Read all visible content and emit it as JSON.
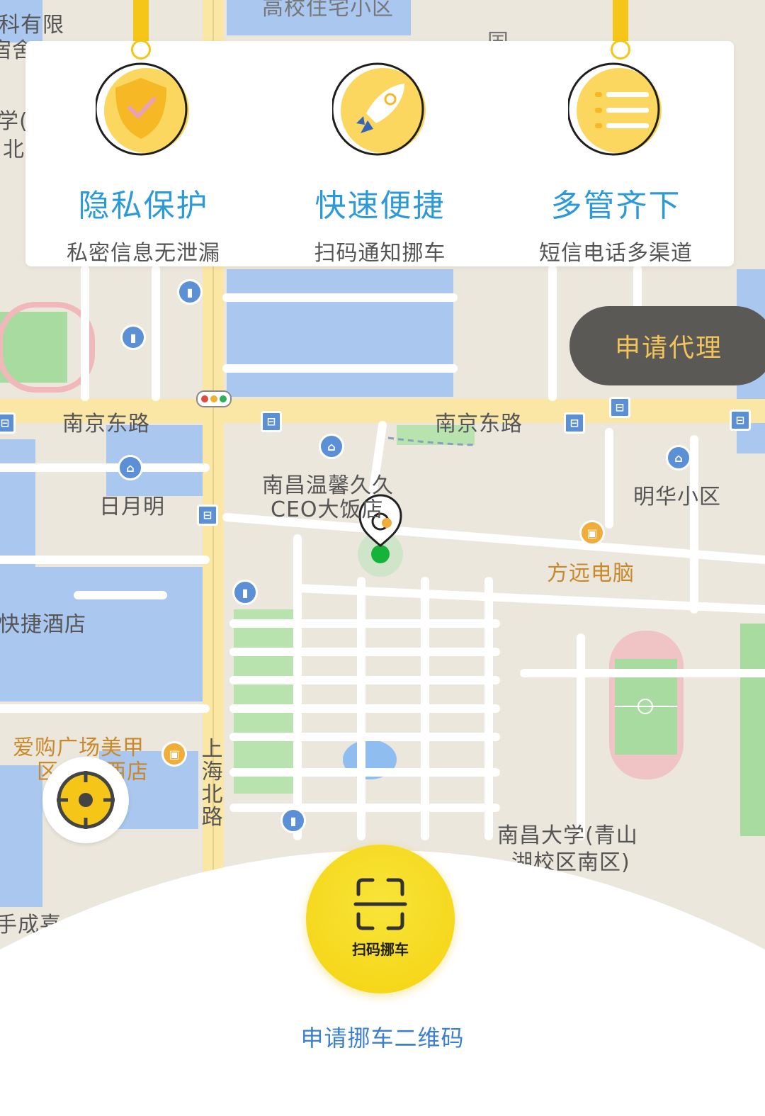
{
  "colors": {
    "accent_yellow": "#f5d30f",
    "title_blue": "#2c9ad8",
    "agent_bg": "#5b5955",
    "agent_text": "#f2c45a",
    "link_blue": "#3b7fd0",
    "map_bg": "#ece7dd",
    "map_water": "#a9c7ef",
    "map_green": "#a8dba0",
    "map_road": "#ffffff",
    "map_main_road": "#fbe7a5"
  },
  "features": [
    {
      "icon": "shield-check-icon",
      "title": "隐私保护",
      "subtitle": "私密信息无泄漏"
    },
    {
      "icon": "rocket-icon",
      "title": "快速便捷",
      "subtitle": "扫码通知挪车"
    },
    {
      "icon": "list-menu-icon",
      "title": "多管齐下",
      "subtitle": "短信电话多渠道"
    }
  ],
  "agent_button": {
    "label": "申请代理"
  },
  "map": {
    "labels": {
      "road_1": "南京东路",
      "road_2": "南京东路",
      "road_vertical": "上海北路",
      "place_1": "日月明",
      "place_2": "南昌温馨久久",
      "place_2b": "CEO大饭店",
      "place_3": "明华小区",
      "place_4": "方远电脑",
      "place_5": "快捷酒店",
      "place_6": "爱购广场美甲",
      "place_6b": "区",
      "place_6c": "西店",
      "place_7": "南昌大学(青山",
      "place_7b": "湖校区南区)",
      "edge_1": "科有限",
      "edge_2": "宿舍",
      "edge_3": "学(",
      "edge_4": "北",
      "edge_5": "高校住宅小区",
      "edge_6": "国",
      "edge_7": "手成喜"
    }
  },
  "scan_button": {
    "label": "扫码挪车"
  },
  "apply_link": {
    "label": "申请挪车二维码"
  }
}
